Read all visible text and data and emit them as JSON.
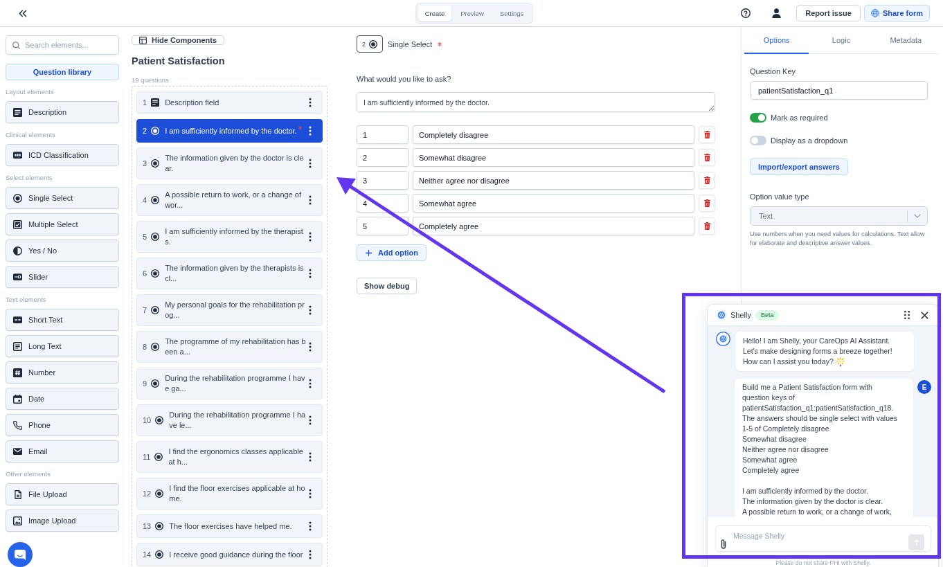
{
  "top_bar": {
    "mode_tabs": [
      {
        "label": "Create",
        "selected": true
      },
      {
        "label": "Preview",
        "selected": false
      },
      {
        "label": "Settings",
        "selected": false
      }
    ],
    "buttons": [
      {
        "kind": "outline",
        "label": "Report issue"
      },
      {
        "kind": "share",
        "label": "Share form"
      }
    ]
  },
  "element_library": {
    "search": {
      "placeholder": "Search elements..."
    },
    "library_button": "Question library",
    "sections": [
      {
        "title": "Layout elements",
        "items": [
          {
            "kind": "description",
            "label": "Description"
          }
        ]
      },
      {
        "title": "Clinical elements",
        "items": [
          {
            "kind": "icd",
            "label": "ICD Classification"
          }
        ]
      },
      {
        "title": "Select elements",
        "items": [
          {
            "kind": "single",
            "label": "Single Select"
          },
          {
            "kind": "multiple",
            "label": "Multiple Select"
          },
          {
            "kind": "yesno",
            "label": "Yes / No"
          },
          {
            "kind": "slider",
            "label": "Slider"
          }
        ]
      },
      {
        "title": "Text elements",
        "items": [
          {
            "kind": "shorttext",
            "label": "Short Text"
          },
          {
            "kind": "longtext",
            "label": "Long Text"
          },
          {
            "kind": "number",
            "label": "Number"
          },
          {
            "kind": "date",
            "label": "Date"
          },
          {
            "kind": "phone",
            "label": "Phone"
          },
          {
            "kind": "email",
            "label": "Email"
          }
        ]
      },
      {
        "title": "Other elements",
        "items": [
          {
            "kind": "file",
            "label": "File Upload"
          },
          {
            "kind": "image",
            "label": "Image Upload"
          }
        ]
      }
    ]
  },
  "form": {
    "hide_button": "Hide Components",
    "title": "Patient Satisfaction",
    "count": "19 questions",
    "questions": [
      {
        "number": "1",
        "kind": "description",
        "text": "Description field",
        "selected": false,
        "required": false
      },
      {
        "number": "2",
        "kind": "single",
        "text": "I am sufficiently informed by the doctor.",
        "selected": true,
        "required": true
      },
      {
        "number": "3",
        "kind": "single",
        "text": "The information given by the doctor is clear.",
        "selected": false,
        "required": false
      },
      {
        "number": "4",
        "kind": "single",
        "text": "A possible return to work, or a change of wor...",
        "selected": false,
        "required": false
      },
      {
        "number": "5",
        "kind": "single",
        "text": "I am sufficiently informed by the therapists.",
        "selected": false,
        "required": false
      },
      {
        "number": "6",
        "kind": "single",
        "text": "The information given by the therapists is cl...",
        "selected": false,
        "required": false
      },
      {
        "number": "7",
        "kind": "single",
        "text": "My personal goals for the rehabilitation prog...",
        "selected": false,
        "required": false
      },
      {
        "number": "8",
        "kind": "single",
        "text": "The programme of my rehabilitation has been a...",
        "selected": false,
        "required": false
      },
      {
        "number": "9",
        "kind": "single",
        "text": "During the rehabilitation programme I have ga...",
        "selected": false,
        "required": false
      },
      {
        "number": "10",
        "kind": "single",
        "text": "During the rehabilitation programme I have le...",
        "selected": false,
        "required": false
      },
      {
        "number": "11",
        "kind": "single",
        "text": "I find the ergonomics classes applicable at h...",
        "selected": false,
        "required": false
      },
      {
        "number": "12",
        "kind": "single",
        "text": "I find the floor exercises applicable at home.",
        "selected": false,
        "required": false
      },
      {
        "number": "13",
        "kind": "single",
        "text": "The floor exercises have helped me.",
        "selected": false,
        "required": false
      },
      {
        "number": "14",
        "kind": "single",
        "text": "I receive good guidance during the floor",
        "selected": false,
        "required": false
      }
    ]
  },
  "editor": {
    "badge_number": "2",
    "kind": "single",
    "type_label": "Single Select",
    "required": true,
    "prompt_label": "What would you like to ask?",
    "question_text": "I am sufficiently informed by the doctor.",
    "options": [
      {
        "value": "1",
        "label": "Completely disagree"
      },
      {
        "value": "2",
        "label": "Somewhat disagree"
      },
      {
        "value": "3",
        "label": "Neither agree nor disagree"
      },
      {
        "value": "4",
        "label": "Somewhat agree"
      },
      {
        "value": "5",
        "label": "Completely agree"
      }
    ],
    "add_button": "Add option",
    "debug_button": "Show debug"
  },
  "settings_panel": {
    "tabs": [
      {
        "label": "Options",
        "selected": true
      },
      {
        "label": "Logic",
        "selected": false
      },
      {
        "label": "Metadata",
        "selected": false
      }
    ],
    "question_key": {
      "label": "Question Key",
      "value": "patientSatisfaction_q1"
    },
    "toggles": [
      {
        "label": "Mark as required",
        "on": true
      },
      {
        "label": "Display as a dropdown",
        "on": false
      }
    ],
    "import_button": "Import/export answers",
    "value_type": {
      "label": "Option value type",
      "value": "Text",
      "disabled": true,
      "help": "Use numbers when you need values for calculations. Text allow for elaborate and descriptive answer values."
    }
  },
  "assistant": {
    "title": "Shelly",
    "badge": "Beta",
    "messages": [
      {
        "kind": "assistant",
        "lines": [
          "Hello! I am Shelly, your CareOps AI Assistant.",
          "Let's make designing forms a breeze together!",
          "How can I assist you today?"
        ]
      },
      {
        "kind": "user",
        "avatar": "E",
        "text": "Build me a Patient Satisfaction form with\nquestion keys of\npatientSatisfaction_q1:patientSatisfaction_q18.\nThe answers should be single select with values\n1-5 of Completely disagree\nSomewhat disagree\nNeither agree nor disagree\nSomewhat agree\nCompletely agree\n\nI am sufficiently informed by the doctor.\nThe information given by the doctor is clear.\nA possible return to work, or a change of work,"
      }
    ],
    "input": {
      "placeholder": "Message Shelly"
    },
    "note": "Please do not share PHI with Shelly."
  }
}
